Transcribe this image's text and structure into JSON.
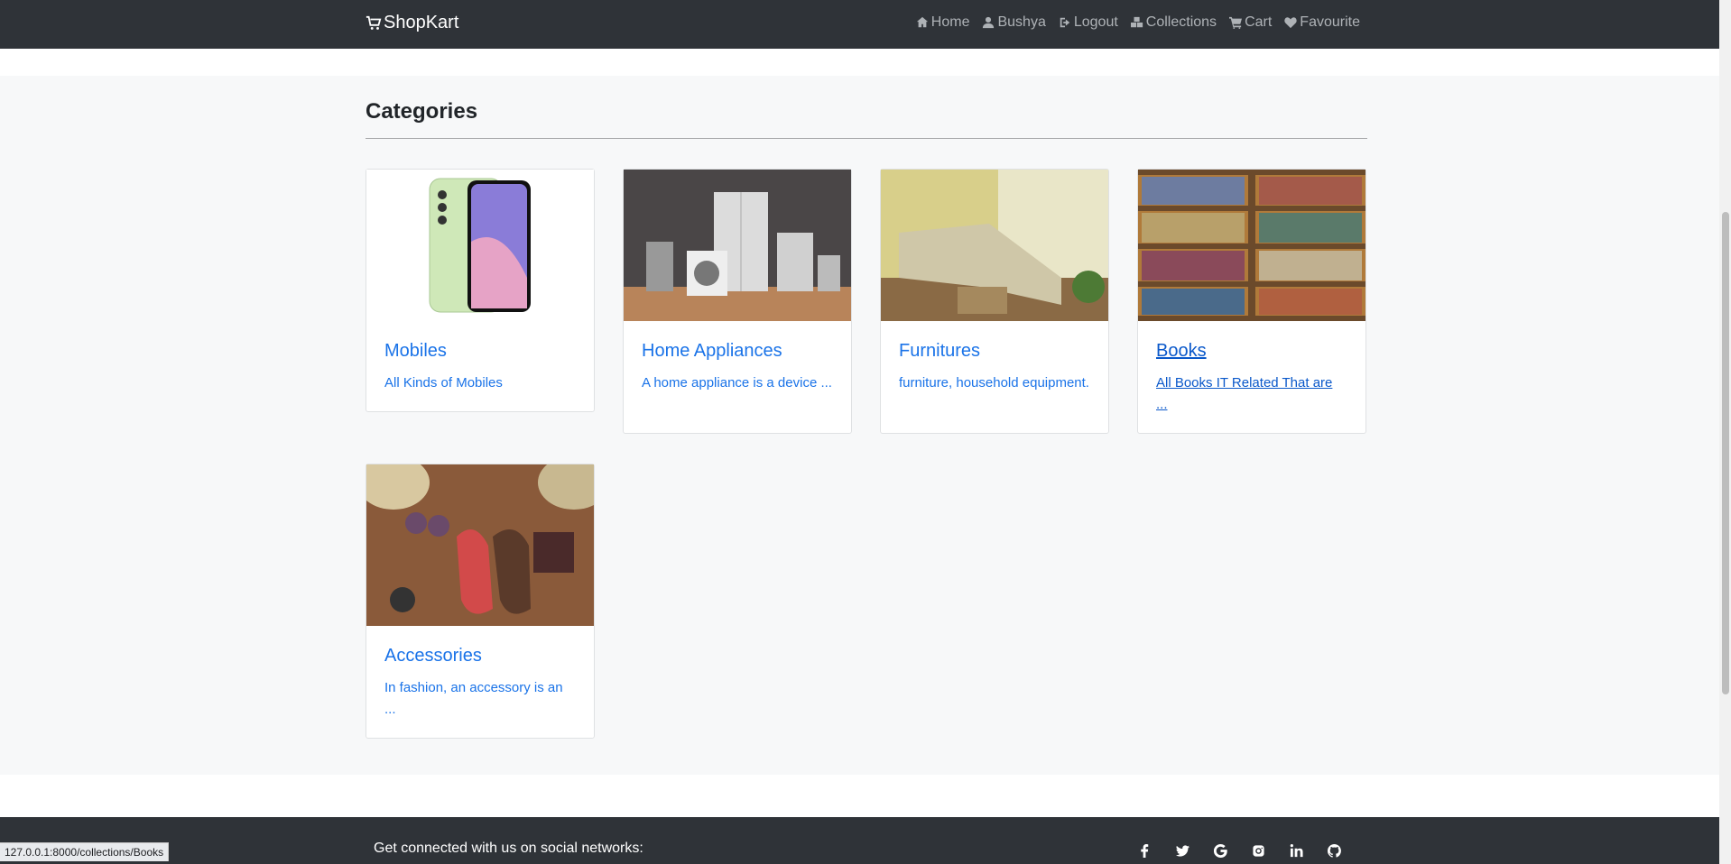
{
  "navbar": {
    "brand": "ShopKart",
    "links": [
      {
        "label": "Home",
        "icon": "home-icon"
      },
      {
        "label": "Bushya",
        "icon": "user-icon"
      },
      {
        "label": "Logout",
        "icon": "logout-icon"
      },
      {
        "label": "Collections",
        "icon": "cubes-icon"
      },
      {
        "label": "Cart",
        "icon": "cart-icon"
      },
      {
        "label": "Favourite",
        "icon": "heart-icon"
      }
    ]
  },
  "main": {
    "heading": "Categories",
    "cards": [
      {
        "title": "Mobiles",
        "text": "All Kinds of Mobiles"
      },
      {
        "title": "Home Appliances",
        "text": "A home appliance is a device ..."
      },
      {
        "title": "Furnitures",
        "text": "furniture, household equipment."
      },
      {
        "title": "Books",
        "text": "All Books IT Related That are ..."
      },
      {
        "title": "Accessories",
        "text": "In fashion, an accessory is an ..."
      }
    ]
  },
  "footer": {
    "text": "Get connected with us on social networks:",
    "socials": [
      "facebook-icon",
      "twitter-icon",
      "google-icon",
      "instagram-icon",
      "linkedin-icon",
      "github-icon"
    ]
  },
  "status_bar": "127.0.0.1:8000/collections/Books",
  "colors": {
    "navbar": "#2f3338",
    "link": "#1a73e8",
    "background": "#f7f8f9"
  }
}
